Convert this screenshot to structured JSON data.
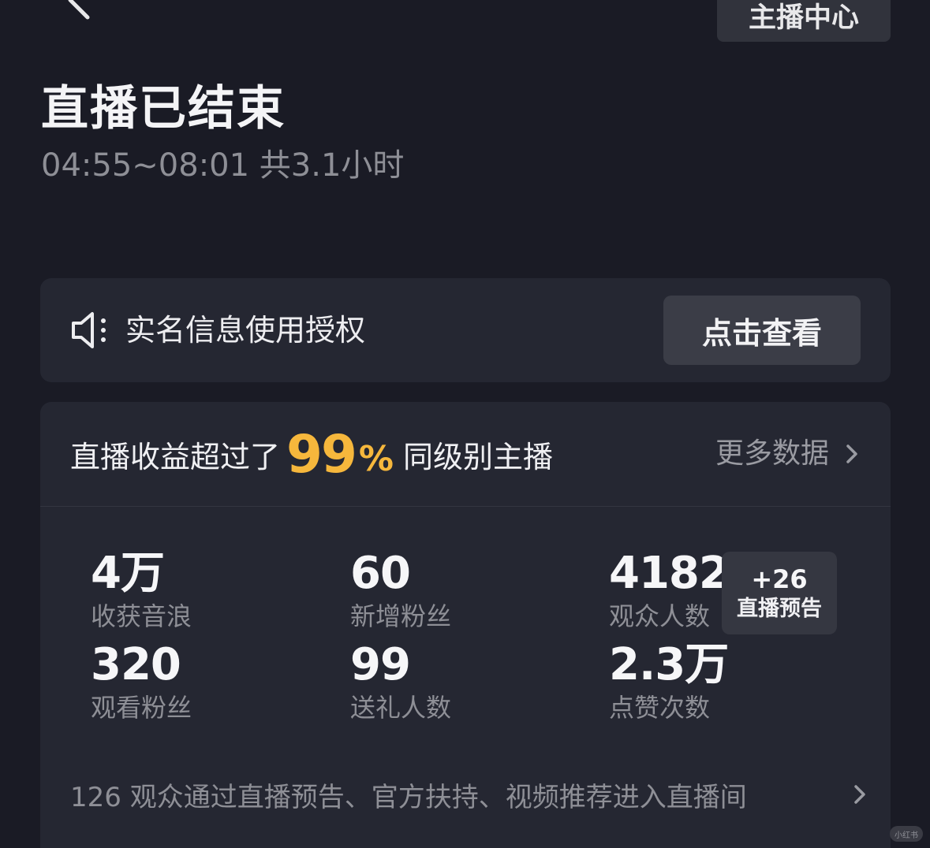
{
  "header": {
    "center_button_label": "主播中心"
  },
  "summary": {
    "title": "直播已结束",
    "time_range": "04:55~08:01 共3.1小时"
  },
  "notice": {
    "text": "实名信息使用授权",
    "button_label": "点击查看"
  },
  "ranking": {
    "prefix": "直播收益超过了",
    "value": "99",
    "unit": "%",
    "suffix": "同级别主播",
    "more_label": "更多数据"
  },
  "stats": [
    {
      "value": "4万",
      "label": "收获音浪"
    },
    {
      "value": "60",
      "label": "新增粉丝"
    },
    {
      "value": "4182",
      "label": "观众人数"
    },
    {
      "value": "320",
      "label": "观看粉丝"
    },
    {
      "value": "99",
      "label": "送礼人数"
    },
    {
      "value": "2.3万",
      "label": "点赞次数"
    }
  ],
  "preview_badge": {
    "count": "+26",
    "label": "直播预告"
  },
  "source_line": "126 观众通过直播预告、官方扶持、视频推荐进入直播间",
  "watermark": "小红书",
  "icons": {
    "back": "chevron-left-icon",
    "speaker": "speaker-icon",
    "more": "chevron-right-icon"
  },
  "colors": {
    "background": "#1a1b25",
    "card": "#252732",
    "accent": "#f6b73c"
  }
}
